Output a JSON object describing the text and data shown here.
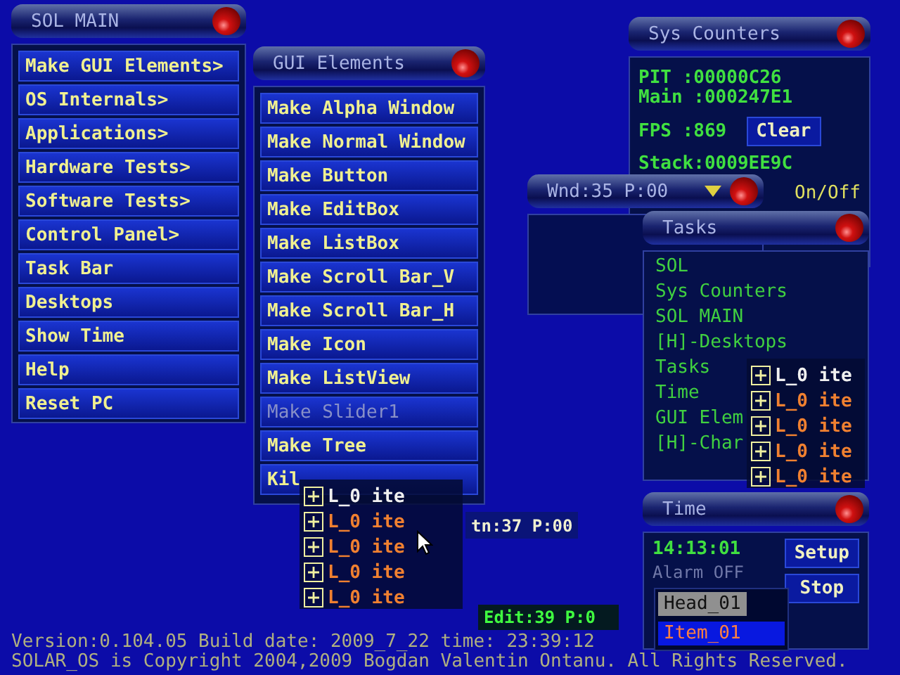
{
  "sol_main": {
    "title": "SOL MAIN",
    "items": [
      {
        "label": "Make GUI Elements>"
      },
      {
        "label": "OS Internals>"
      },
      {
        "label": "Applications>"
      },
      {
        "label": "Hardware Tests>"
      },
      {
        "label": "Software Tests>"
      },
      {
        "label": "Control Panel>"
      },
      {
        "label": "Task Bar"
      },
      {
        "label": "Desktops"
      },
      {
        "label": "Show Time"
      },
      {
        "label": "Help"
      },
      {
        "label": "Reset PC"
      }
    ]
  },
  "gui_elements": {
    "title": "GUI Elements",
    "items": [
      {
        "label": "Make Alpha Window",
        "disabled": false
      },
      {
        "label": "Make Normal Window",
        "disabled": false
      },
      {
        "label": "Make Button",
        "disabled": false
      },
      {
        "label": "Make EditBox",
        "disabled": false
      },
      {
        "label": "Make ListBox",
        "disabled": false
      },
      {
        "label": "Make Scroll Bar_V",
        "disabled": false
      },
      {
        "label": "Make Scroll Bar_H",
        "disabled": false
      },
      {
        "label": "Make Icon",
        "disabled": false
      },
      {
        "label": "Make ListView",
        "disabled": false
      },
      {
        "label": "Make Slider1",
        "disabled": true
      },
      {
        "label": "Make Tree",
        "disabled": false
      },
      {
        "label": "Kil",
        "disabled": false
      }
    ]
  },
  "sys_counters": {
    "title": "Sys Counters",
    "lines": [
      "PIT  :00000C26",
      "Main :000247E1"
    ],
    "fps": "FPS  :869",
    "clear_button": "Clear",
    "stack": "Stack:0009EE9C",
    "toggle": "On/Off"
  },
  "wnd_window": {
    "title": "Wnd:35 P:00"
  },
  "tasks": {
    "title": "Tasks",
    "items": [
      {
        "label": "SOL"
      },
      {
        "label": "Sys Counters"
      },
      {
        "label": "SOL MAIN"
      },
      {
        "label": "[H]-Desktops"
      },
      {
        "label": "Tasks"
      },
      {
        "label": "Time"
      },
      {
        "label": "GUI Elem"
      },
      {
        "label": "[H]-Char"
      }
    ]
  },
  "trees": [
    {
      "items": [
        {
          "label": "L_0 ite",
          "selected": true
        },
        {
          "label": "L_0 ite",
          "selected": false
        },
        {
          "label": "L_0 ite",
          "selected": false
        },
        {
          "label": "L_0 ite",
          "selected": false
        },
        {
          "label": "L_0 ite",
          "selected": false
        }
      ]
    },
    {
      "items": [
        {
          "label": "L_0 ite",
          "selected": true
        },
        {
          "label": "L_0 ite",
          "selected": false
        },
        {
          "label": "L_0 ite",
          "selected": false
        },
        {
          "label": "L_0 ite",
          "selected": false
        },
        {
          "label": "L_0 ite",
          "selected": false
        }
      ]
    }
  ],
  "btn_window": {
    "title": "tn:37 P:00"
  },
  "edit_window": {
    "title": "Edit:39 P:0"
  },
  "time_window": {
    "title": "Time",
    "clock": "14:13:01",
    "alarm": "Alarm OFF",
    "buttons": [
      "Setup",
      "Stop"
    ],
    "listbox": {
      "header": "Head_01",
      "items": [
        {
          "label": "Item_01",
          "selected": true
        }
      ]
    }
  },
  "footer": {
    "version": "Version:0.104.05  Build date: 2009_7_22  time: 23:39:12",
    "copyright": "SOLAR_OS is Copyright 2004,2009 Bogdan Valentin Ontanu. All Rights Reserved."
  }
}
